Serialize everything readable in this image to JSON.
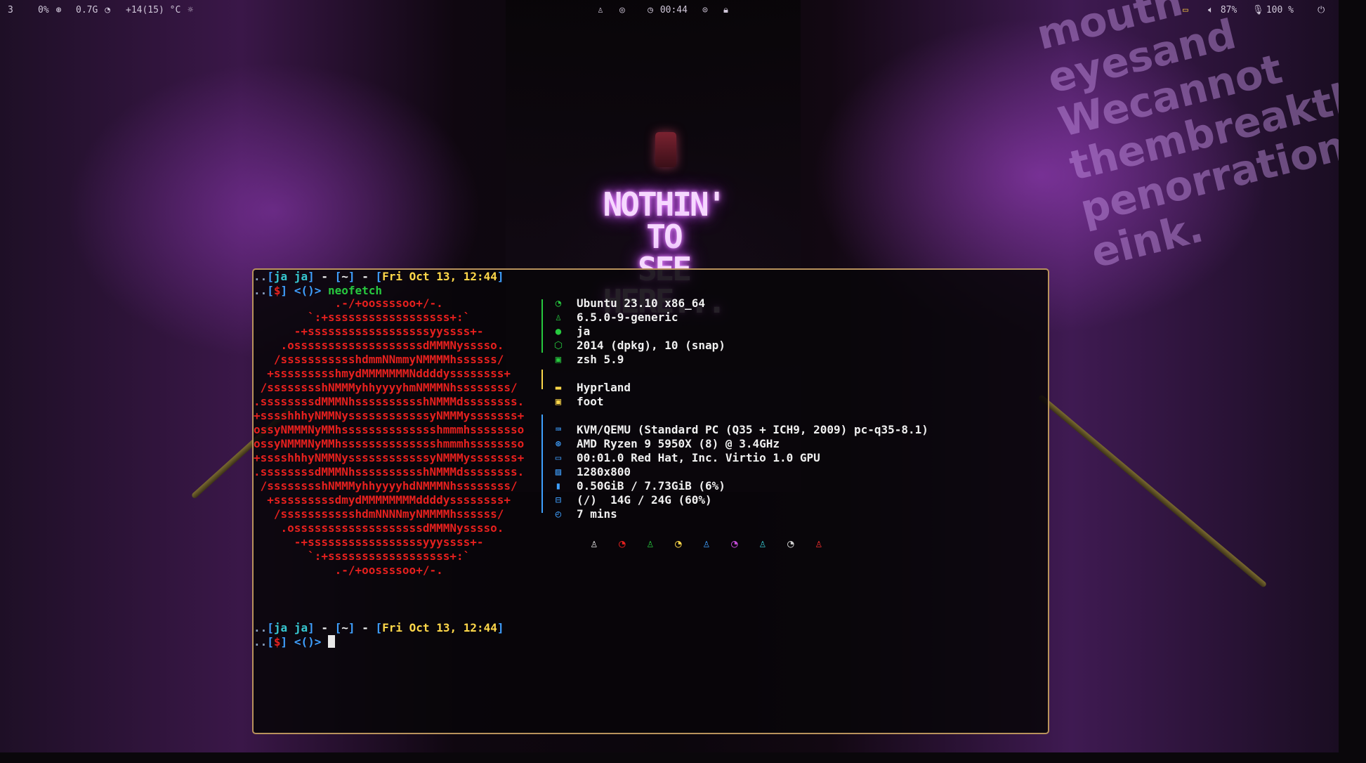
{
  "topbar": {
    "workspace": "3",
    "cpu": "0%",
    "memory": "0.7G",
    "temperature": "+14(15) °C",
    "clock": "00:44",
    "battery": "87%",
    "volume": "100 %"
  },
  "wallpaper": {
    "neon_line1": "NOTHIN' TO",
    "neon_line2": "SEE HERE...",
    "graffiti": "mouth\neyesand\nWecannot\nthembreakth\npenorration\neink."
  },
  "terminal": {
    "prompt1": {
      "user": "ja",
      "host": "ja",
      "dir": "~",
      "date": "Fri Oct 13, 12:44",
      "cmd": "neofetch"
    },
    "prompt2": {
      "user": "ja",
      "host": "ja",
      "dir": "~",
      "date": "Fri Oct 13, 12:44"
    },
    "prompt_symbol": "$",
    "prompt_tail": "<()>",
    "ascii_art": [
      "            .-/+oossssoo+/-.",
      "        `:+ssssssssssssssssss+:`",
      "      -+ssssssssssssssssssyyssss+-",
      "    .osssssssssssssssssssdMMMNysssso.",
      "   /ssssssssssshdmmNNmmyNMMMMhssssss/",
      "  +ssssssssshmydMMMMMMMNddddyssssssss+",
      " /sssssssshNMMMyhhyyyyhmNMMMNhssssssss/",
      ".ssssssssdMMMNhsssssssssshNMMMdssssssss.",
      "+sssshhhyNMMNyssssssssssssyNMMMysssssss+",
      "ossyNMMMNyMMhsssssssssssssshmmmhssssssso",
      "ossyNMMMNyMMhsssssssssssssshmmmhssssssso",
      "+sssshhhyNMMNyssssssssssssyNMMMysssssss+",
      ".ssssssssdMMMNhsssssssssshNMMMdssssssss.",
      " /sssssssshNMMMyhhyyyyhdNMMMNhssssssss/",
      "  +sssssssssdmydMMMMMMMMddddyssssssss+",
      "   /ssssssssssshdmNNNNmyNMMMMhssssss/",
      "    .osssssssssssssssssssdMMMNysssso.",
      "      -+sssssssssssssssssyyyssss+-",
      "        `:+ssssssssssssssssss+:`",
      "            .-/+oossssoo+/-."
    ],
    "info": {
      "os": "Ubuntu 23.10 x86_64",
      "kernel": "6.5.0-9-generic",
      "user": "ja",
      "packages": "2014 (dpkg), 10 (snap)",
      "shell": "zsh 5.9",
      "wm": "Hyprland",
      "terminal": "foot",
      "host": "KVM/QEMU (Standard PC (Q35 + ICH9, 2009) pc-q35-8.1)",
      "cpu": "AMD Ryzen 9 5950X (8) @ 3.4GHz",
      "gpu": "00:01.0 Red Hat, Inc. Virtio 1.0 GPU",
      "resolution": "1280x800",
      "memory": "0.50GiB / 7.73GiB (6%)",
      "disk": "(/)  14G / 24G (60%)",
      "uptime": "7 mins"
    },
    "palette": [
      "#eeeeee",
      "#e5201e",
      "#27c93f",
      "#ffd84a",
      "#3fa0ff",
      "#c44bd8",
      "#37c7d0",
      "#d0d0d0",
      "#ff3030"
    ],
    "palette_icons": [
      "tux-icon",
      "debian-icon",
      "tux-icon",
      "debian-icon",
      "tux-icon",
      "debian-icon",
      "tux-icon",
      "debian-icon",
      "tux-icon"
    ]
  }
}
